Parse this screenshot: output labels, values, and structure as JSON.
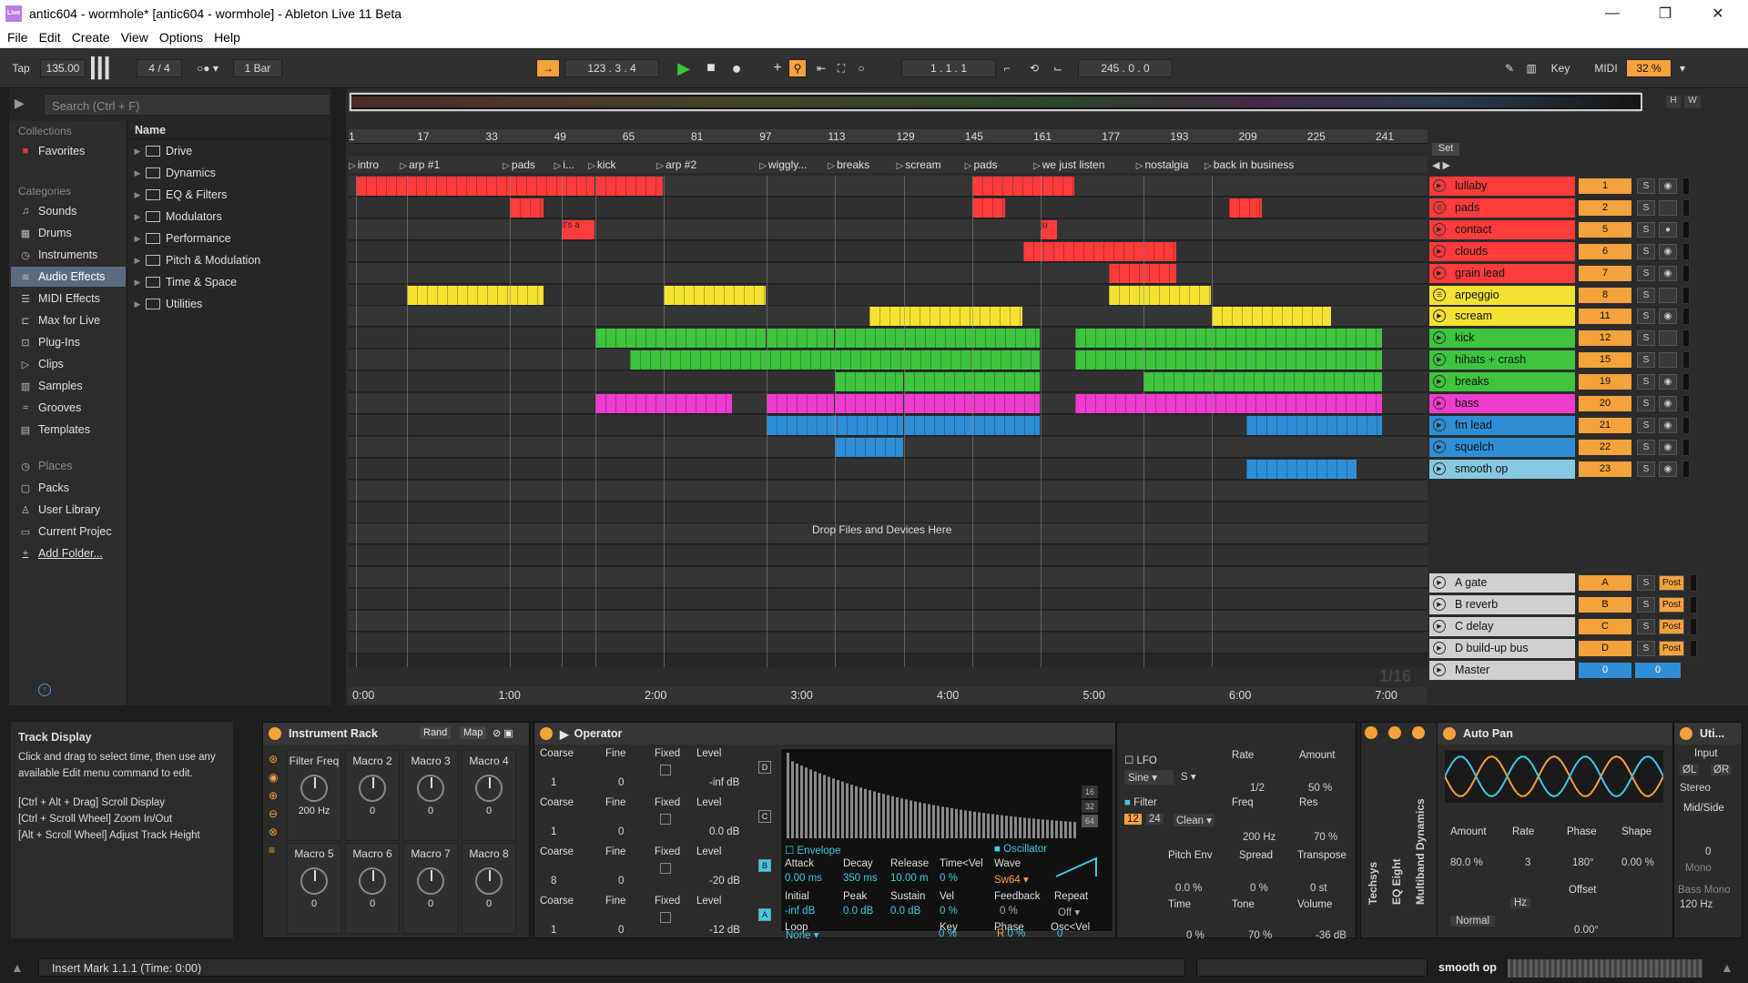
{
  "window": {
    "title": "antic604 - wormhole*  [antic604 - wormhole] - Ableton Live 11 Beta",
    "logo_text": "Live",
    "minimize": "—",
    "maximize": "❐",
    "close": "✕"
  },
  "menu": [
    "File",
    "Edit",
    "Create",
    "View",
    "Options",
    "Help"
  ],
  "transport": {
    "tap": "Tap",
    "tempo": "135.00",
    "signature": "4 / 4",
    "quantize": "1 Bar",
    "position": "123 .  3 .  4",
    "loop_start": "1 .  1 .  1",
    "loop_length": "245 .  0 .  0",
    "key": "Key",
    "midi": "MIDI",
    "cpu": "32 %"
  },
  "browser": {
    "search_placeholder": "Search (Ctrl + F)",
    "collections_label": "Collections",
    "favorites": "Favorites",
    "categories_label": "Categories",
    "categories": [
      {
        "label": "Sounds",
        "icon": "sounds-icon",
        "glyph": "♫"
      },
      {
        "label": "Drums",
        "icon": "drums-icon",
        "glyph": "▦"
      },
      {
        "label": "Instruments",
        "icon": "instruments-icon",
        "glyph": "◷"
      },
      {
        "label": "Audio Effects",
        "icon": "audio-effects-icon",
        "glyph": "≋"
      },
      {
        "label": "MIDI Effects",
        "icon": "midi-effects-icon",
        "glyph": "☰"
      },
      {
        "label": "Max for Live",
        "icon": "max-icon",
        "glyph": "⊏"
      },
      {
        "label": "Plug-Ins",
        "icon": "plugins-icon",
        "glyph": "⊡"
      },
      {
        "label": "Clips",
        "icon": "clips-icon",
        "glyph": "▷"
      },
      {
        "label": "Samples",
        "icon": "samples-icon",
        "glyph": "▥"
      },
      {
        "label": "Grooves",
        "icon": "grooves-icon",
        "glyph": "≈"
      },
      {
        "label": "Templates",
        "icon": "templates-icon",
        "glyph": "▤"
      }
    ],
    "places_label": "Places",
    "places": [
      {
        "label": "Packs",
        "icon": "packs-icon",
        "glyph": "▢"
      },
      {
        "label": "User Library",
        "icon": "user-library-icon",
        "glyph": "♙"
      },
      {
        "label": "Current Projec",
        "icon": "current-project-icon",
        "glyph": "▭"
      },
      {
        "label": "Add Folder...",
        "icon": "add-folder-icon",
        "glyph": "+"
      }
    ],
    "name_header": "Name",
    "folders": [
      "Drive",
      "Dynamics",
      "EQ & Filters",
      "Modulators",
      "Performance",
      "Pitch & Modulation",
      "Time & Space",
      "Utilities"
    ]
  },
  "arrangement": {
    "ruler": [
      "1",
      "17",
      "33",
      "49",
      "65",
      "81",
      "97",
      "113",
      "129",
      "145",
      "161",
      "177",
      "193",
      "209",
      "225",
      "241"
    ],
    "set_label": "Set",
    "locators": [
      {
        "label": "intro",
        "bar": 1
      },
      {
        "label": "arp #1",
        "bar": 13
      },
      {
        "label": "pads",
        "bar": 37
      },
      {
        "label": "i...",
        "bar": 49
      },
      {
        "label": "kick",
        "bar": 57
      },
      {
        "label": "arp #2",
        "bar": 73
      },
      {
        "label": "wiggly...",
        "bar": 97
      },
      {
        "label": "breaks",
        "bar": 113
      },
      {
        "label": "scream",
        "bar": 129
      },
      {
        "label": "pads",
        "bar": 145
      },
      {
        "label": "we just listen",
        "bar": 161
      },
      {
        "label": "nostalgia",
        "bar": 185
      },
      {
        "label": "back in business",
        "bar": 201
      }
    ],
    "drop_text": "Drop Files and Devices Here",
    "zoom_readout": "1/16",
    "times": [
      "0:00",
      "1:00",
      "2:00",
      "3:00",
      "4:00",
      "5:00",
      "6:00",
      "7:00"
    ],
    "clip_labels": {
      "contact_a": "it's a",
      "contact_b": "ju"
    }
  },
  "tracks": [
    {
      "name": "lullaby",
      "num": "1",
      "color": "#ff3b3b",
      "play": "▶",
      "arm": "◉"
    },
    {
      "name": "pads",
      "num": "2",
      "color": "#ff3b3b",
      "play": "☰",
      "arm": ""
    },
    {
      "name": "contact",
      "num": "5",
      "color": "#ff3b3b",
      "play": "▶",
      "arm": "●"
    },
    {
      "name": "clouds",
      "num": "6",
      "color": "#ff3b3b",
      "play": "▶",
      "arm": "◉"
    },
    {
      "name": "grain lead",
      "num": "7",
      "color": "#ff3b3b",
      "play": "▶",
      "arm": "◉"
    },
    {
      "name": "arpeggio",
      "num": "8",
      "color": "#f4e233",
      "play": "☰",
      "arm": ""
    },
    {
      "name": "scream",
      "num": "11",
      "color": "#f4e233",
      "play": "▶",
      "arm": "◉"
    },
    {
      "name": "kick",
      "num": "12",
      "color": "#3ec43e",
      "play": "▶",
      "arm": ""
    },
    {
      "name": "hihats + crash",
      "num": "15",
      "color": "#3ec43e",
      "play": "▶",
      "arm": ""
    },
    {
      "name": "breaks",
      "num": "19",
      "color": "#3ec43e",
      "play": "▶",
      "arm": "◉"
    },
    {
      "name": "bass",
      "num": "20",
      "color": "#ee3ccf",
      "play": "▶",
      "arm": "◉"
    },
    {
      "name": "fm lead",
      "num": "21",
      "color": "#2f8fd6",
      "play": "▶",
      "arm": "◉"
    },
    {
      "name": "squelch",
      "num": "22",
      "color": "#2f8fd6",
      "play": "▶",
      "arm": "◉"
    },
    {
      "name": "smooth op",
      "num": "23",
      "color": "#86c9e2",
      "play": "▶",
      "arm": "◉"
    }
  ],
  "returns": [
    {
      "name": "A gate",
      "letter": "A",
      "post": "Post"
    },
    {
      "name": "B reverb",
      "letter": "B",
      "post": "Post"
    },
    {
      "name": "C delay",
      "letter": "C",
      "post": "Post"
    },
    {
      "name": "D build-up bus",
      "letter": "D",
      "post": "Post"
    }
  ],
  "master": {
    "name": "Master",
    "a": "0",
    "b": "0"
  },
  "info": {
    "title": "Track Display",
    "body": "Click and drag to select time, then use any available Edit menu command to edit.",
    "l1": "[Ctrl + Alt + Drag] Scroll Display",
    "l2": "[Ctrl + Scroll Wheel] Zoom In/Out",
    "l3": "[Alt + Scroll Wheel] Adjust Track Height"
  },
  "rack": {
    "title": "Instrument Rack",
    "rand": "Rand",
    "map": "Map",
    "macros": [
      {
        "label": "Filter Freq",
        "value": "200 Hz"
      },
      {
        "label": "Macro 2",
        "value": "0"
      },
      {
        "label": "Macro 3",
        "value": "0"
      },
      {
        "label": "Macro 4",
        "value": "0"
      },
      {
        "label": "Macro 5",
        "value": "0"
      },
      {
        "label": "Macro 6",
        "value": "0"
      },
      {
        "label": "Macro 7",
        "value": "0"
      },
      {
        "label": "Macro 8",
        "value": "0"
      }
    ]
  },
  "operator": {
    "title": "Operator",
    "rows": [
      {
        "coarse": "1",
        "fine": "0",
        "fixed": "Fixed",
        "level": "-inf dB",
        "osc": "D"
      },
      {
        "coarse": "1",
        "fine": "0",
        "fixed": "Fixed",
        "level": "0.0 dB",
        "osc": "C"
      },
      {
        "coarse": "8",
        "fine": "0",
        "fixed": "Fixed",
        "level": "-20 dB",
        "osc": "B"
      },
      {
        "coarse": "1",
        "fine": "0",
        "fixed": "Fixed",
        "level": "-12 dB",
        "osc": "A"
      }
    ],
    "labels": {
      "coarse": "Coarse",
      "fine": "Fine",
      "level": "Level"
    },
    "env_label": "Envelope",
    "osc_label": "Oscillator",
    "env": {
      "attack_l": "Attack",
      "attack": "0.00 ms",
      "decay_l": "Decay",
      "decay": "350 ms",
      "release_l": "Release",
      "release": "10.00 m",
      "timevel_l": "Time<Vel",
      "timevel": "0 %",
      "initial_l": "Initial",
      "initial": "-inf dB",
      "peak_l": "Peak",
      "peak": "0.0 dB",
      "sustain_l": "Sustain",
      "sustain": "0.0 dB",
      "vel_l": "Vel",
      "vel": "0 %",
      "loop_l": "Loop",
      "loop": "None",
      "key_l": "Key",
      "key": "0 %"
    },
    "osc": {
      "wave_l": "Wave",
      "wave": "Sw64",
      "feedback_l": "Feedback",
      "feedback": "0 %",
      "repeat_l": "Repeat",
      "repeat": "Off",
      "phase_l": "Phase",
      "phase": "0 %",
      "oscvel_l": "Osc<Vel",
      "oscvel": "0"
    },
    "partials": [
      "16",
      "32",
      "64"
    ]
  },
  "lfo": {
    "lfo": "LFO",
    "wave": "Sine",
    "sync": "S",
    "rate_l": "Rate",
    "rate": "1/2",
    "amount_l": "Amount",
    "amount": "50 %",
    "filter": "Filter",
    "slope1": "12",
    "slope2": "24",
    "type": "Clean",
    "freq_l": "Freq",
    "freq": "200 Hz",
    "res_l": "Res",
    "res": "70 %",
    "pitchenv_l": "Pitch Env",
    "pitchenv": "0.0 %",
    "spread_l": "Spread",
    "spread": "0 %",
    "transpose_l": "Transpose",
    "transpose": "0 st",
    "time_l": "Time",
    "time": "0 %",
    "tone_l": "Tone",
    "tone": "70 %",
    "volume_l": "Volume",
    "volume": "-36 dB"
  },
  "side_devices": [
    "Techsys",
    "EQ Eight",
    "Multiband Dynamics"
  ],
  "autopan": {
    "title": "Auto Pan",
    "amount_l": "Amount",
    "amount": "80.0 %",
    "rate_l": "Rate",
    "rate": "3",
    "phase_l": "Phase",
    "phase": "180°",
    "shape_l": "Shape",
    "shape": "0.00 %",
    "mode": "Normal",
    "hz": "Hz",
    "offset_l": "Offset",
    "offset": "0.00°"
  },
  "utility": {
    "title": "Uti...",
    "input": "Input",
    "l": "ØL",
    "r": "ØR",
    "stereo": "Stereo",
    "midside": "Mid/Side",
    "midside_val": "0",
    "mono": "Mono",
    "bassmono": "Bass Mono",
    "freq": "120 Hz"
  },
  "status": {
    "text": "Insert Mark 1.1.1 (Time: 0:00)",
    "current_track": "smooth op"
  }
}
